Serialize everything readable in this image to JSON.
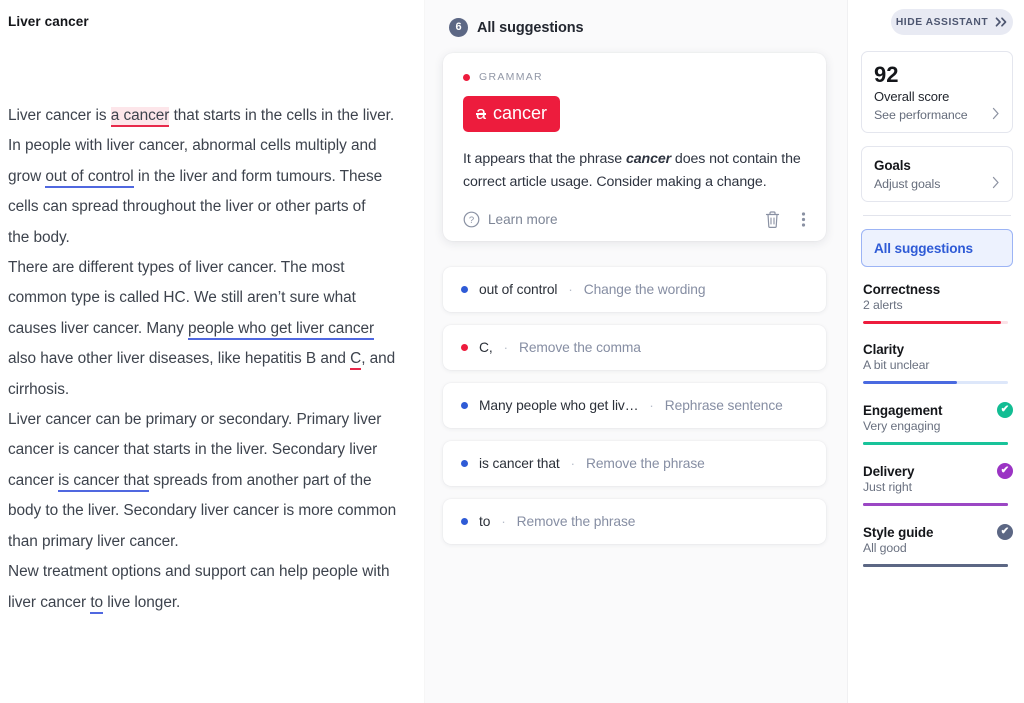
{
  "editor": {
    "title": "Liver cancer",
    "paragraphs": [
      {
        "segments": [
          {
            "t": "Liver cancer is ",
            "mark": "none"
          },
          {
            "t": "a cancer",
            "mark": "hl-red"
          },
          {
            "t": " that starts in the cells in the liver. In people with liver cancer, abnormal cells multiply and grow ",
            "mark": "none"
          },
          {
            "t": "out of control",
            "mark": "u-blue"
          },
          {
            "t": " in the liver and form tumours. These cells can spread throughout the liver or other parts of",
            "mark": "none"
          }
        ]
      },
      {
        "segments": [
          {
            "t": "the body.",
            "mark": "none"
          }
        ]
      },
      {
        "segments": [
          {
            "t": "There are different types of liver cancer. The most common type is called HC. We still aren’t sure what causes liver cancer. Many ",
            "mark": "none"
          },
          {
            "t": "people who get liver cancer",
            "mark": "u-blue"
          },
          {
            "t": " also have other liver diseases, like hepatitis B and ",
            "mark": "none"
          },
          {
            "t": "C",
            "mark": "u-red"
          },
          {
            "t": ", and cirrhosis.",
            "mark": "none"
          }
        ]
      },
      {
        "segments": [
          {
            "t": "Liver cancer can be primary or secondary. Primary liver cancer is cancer that starts in the liver. Secondary liver",
            "mark": "none"
          }
        ]
      },
      {
        "segments": [
          {
            "t": "cancer ",
            "mark": "none"
          },
          {
            "t": "is cancer that",
            "mark": "u-blue"
          },
          {
            "t": " spreads from another part of the body to the liver. Secondary liver cancer is more common than primary liver cancer.",
            "mark": "none"
          }
        ]
      },
      {
        "segments": [
          {
            "t": "New treatment options and support can help people with liver cancer ",
            "mark": "none"
          },
          {
            "t": "to",
            "mark": "u-blue"
          },
          {
            "t": " live longer.",
            "mark": "none"
          }
        ]
      }
    ]
  },
  "suggestions": {
    "count": "6",
    "header_title": "All suggestions",
    "card": {
      "category": "GRAMMAR",
      "category_color": "#ed1c3d",
      "chip_strike": "a",
      "chip_word": "cancer",
      "chip_color": "#ed1c3d",
      "description_pre": "It appears that the phrase ",
      "description_bold": "cancer",
      "description_post": " does not contain the correct article usage. Consider making a change.",
      "learn_more": "Learn more"
    },
    "rows": [
      {
        "dot": "#2f5bd6",
        "text": "out of control",
        "sep": "·",
        "action": "Change the wording"
      },
      {
        "dot": "#ed1c3d",
        "text": "C,",
        "sep": "·",
        "action": "Remove the comma"
      },
      {
        "dot": "#2f5bd6",
        "text": "Many people who get liv…",
        "sep": "·",
        "action": "Rephrase sentence"
      },
      {
        "dot": "#2f5bd6",
        "text": "is cancer that",
        "sep": "·",
        "action": "Remove the phrase"
      },
      {
        "dot": "#2f5bd6",
        "text": "to",
        "sep": "·",
        "action": "Remove the phrase"
      }
    ]
  },
  "assistant": {
    "hide_label": "HIDE ASSISTANT",
    "score": {
      "value": "92",
      "label": "Overall score",
      "link": "See performance"
    },
    "goals": {
      "title": "Goals",
      "link": "Adjust goals"
    },
    "all_suggestions_button": "All suggestions",
    "metrics": [
      {
        "name": "Correctness",
        "status": "2 alerts",
        "bar_color": "#ed1c3d",
        "track_color": "#fbe2e7",
        "fill_pct": "95%",
        "check": false,
        "check_color": ""
      },
      {
        "name": "Clarity",
        "status": "A bit unclear",
        "bar_color": "#4a6ae0",
        "track_color": "#dde7fa",
        "fill_pct": "65%",
        "check": false,
        "check_color": ""
      },
      {
        "name": "Engagement",
        "status": "Very engaging",
        "bar_color": "#18c39a",
        "track_color": "#18c39a",
        "fill_pct": "100%",
        "check": true,
        "check_color": "#12bd93"
      },
      {
        "name": "Delivery",
        "status": "Just right",
        "bar_color": "#9b47c4",
        "track_color": "#9b47c4",
        "fill_pct": "100%",
        "check": true,
        "check_color": "#9b34c4"
      },
      {
        "name": "Style guide",
        "status": "All good",
        "bar_color": "#5c6784",
        "track_color": "#5c6784",
        "fill_pct": "100%",
        "check": true,
        "check_color": "#5c6784"
      }
    ]
  }
}
